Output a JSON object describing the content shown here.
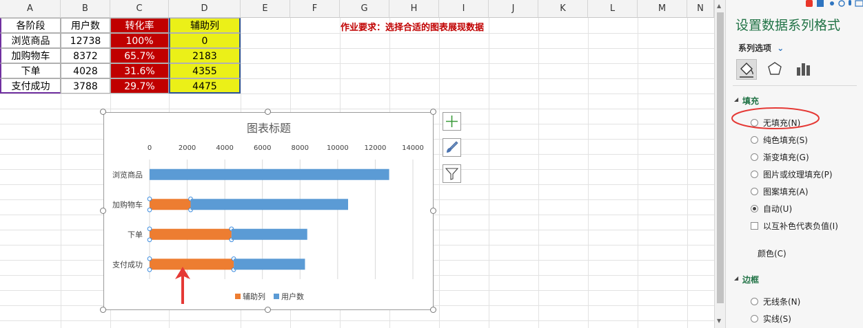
{
  "columns": [
    "A",
    "B",
    "C",
    "D",
    "E",
    "F",
    "G",
    "H",
    "I",
    "J",
    "K",
    "L",
    "M",
    "N"
  ],
  "table": {
    "headers": [
      "各阶段",
      "用户数",
      "转化率",
      "辅助列"
    ],
    "rows": [
      [
        "浏览商品",
        "12738",
        "100%",
        "0"
      ],
      [
        "加购物车",
        "8372",
        "65.7%",
        "2183"
      ],
      [
        "下单",
        "4028",
        "31.6%",
        "4355"
      ],
      [
        "支付成功",
        "3788",
        "29.7%",
        "4475"
      ]
    ]
  },
  "task_note": "作业要求：选择合适的图表展现数据",
  "chart_data": {
    "type": "bar",
    "orientation": "horizontal",
    "stacked": true,
    "title": "图表标题",
    "categories": [
      "浏览商品",
      "加购物车",
      "下单",
      "支付成功"
    ],
    "series": [
      {
        "name": "辅助列",
        "values": [
          0,
          2183,
          4355,
          4475
        ],
        "color": "#ed7d31"
      },
      {
        "name": "用户数",
        "values": [
          12738,
          8372,
          4028,
          3788
        ],
        "color": "#5b9bd5"
      }
    ],
    "xlim": [
      0,
      14000
    ],
    "xticks": [
      0,
      2000,
      4000,
      6000,
      8000,
      10000,
      12000,
      14000
    ],
    "grid": true,
    "legend_position": "bottom",
    "selected_series": "辅助列"
  },
  "pane": {
    "title": "设置数据系列格式",
    "series_options": "系列选项",
    "fill_section": "填充",
    "fill_options": [
      "无填充(N)",
      "纯色填充(S)",
      "渐变填充(G)",
      "图片或纹理填充(P)",
      "图案填充(A)",
      "自动(U)"
    ],
    "selected_fill": "自动(U)",
    "invert_label": "以互补色代表负值(I)",
    "color_label": "颜色(C)",
    "border_section": "边框",
    "border_options": [
      "无线条(N)",
      "实线(S)"
    ]
  },
  "colors": {
    "accent_green": "#217346",
    "header_red": "#c00000",
    "helper_yellow": "#ebf018",
    "highlight_circle": "#e53935",
    "arrow": "#e53935"
  }
}
